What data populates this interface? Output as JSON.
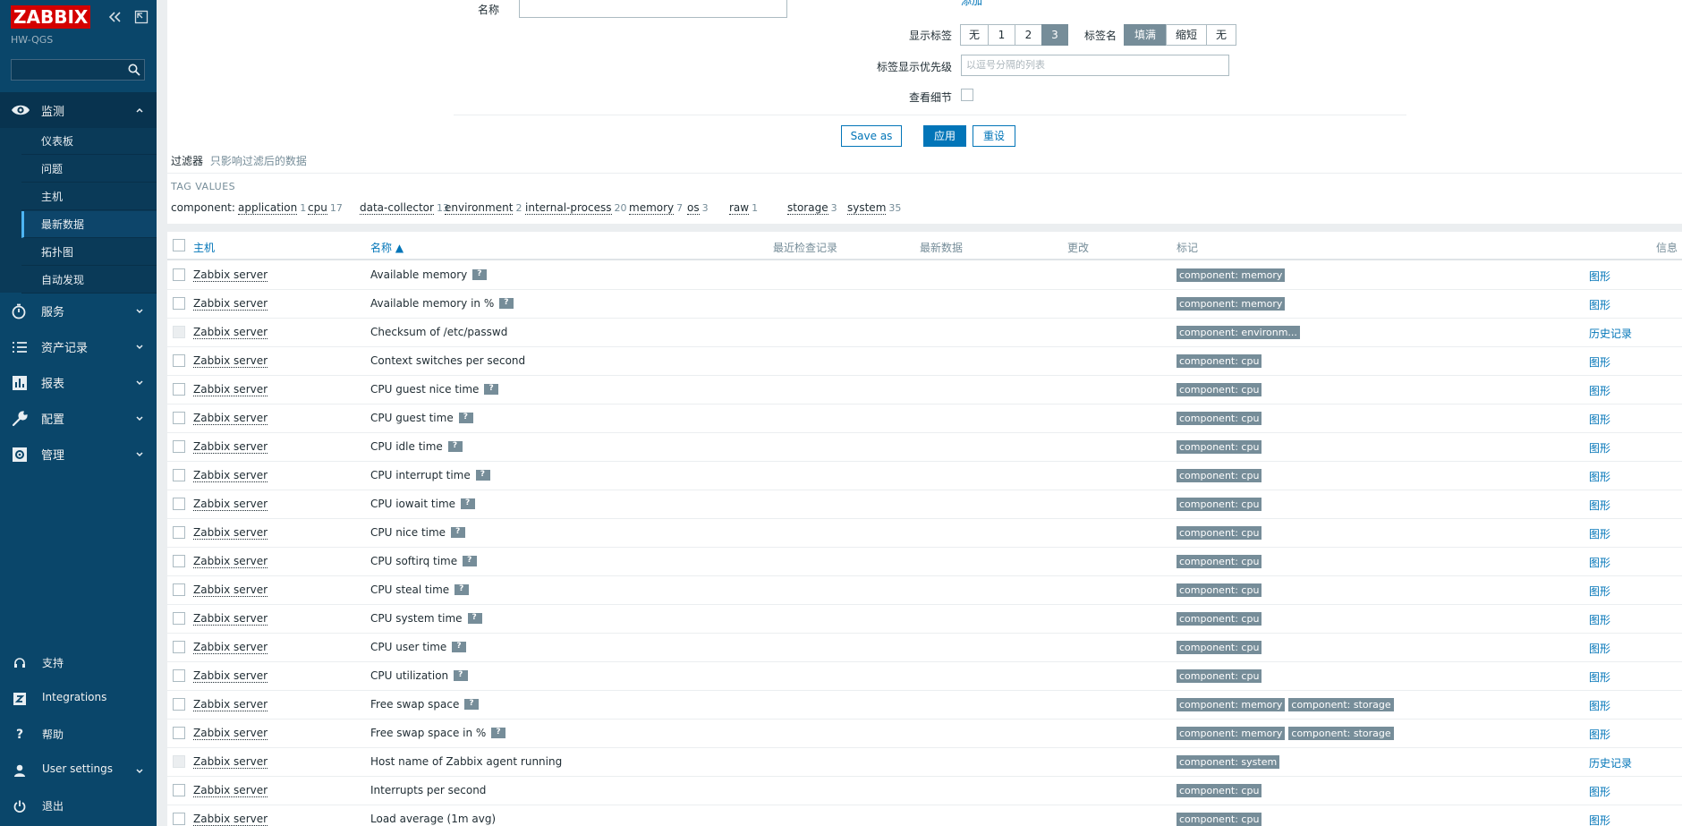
{
  "app": {
    "logo": "ZABBIX",
    "server_name": "HW-QGS",
    "search_placeholder": ""
  },
  "nav": {
    "monitoring": {
      "label": "监测",
      "items": [
        "仪表板",
        "问题",
        "主机",
        "最新数据",
        "拓扑图",
        "自动发现"
      ],
      "active": "最新数据"
    },
    "services": "服务",
    "inventory": "资产记录",
    "reports": "报表",
    "config": "配置",
    "admin": "管理",
    "support": "支持",
    "integrations": "Integrations",
    "help": "帮助",
    "user_settings": "User settings",
    "logout": "退出"
  },
  "filter": {
    "name_label": "名称",
    "name_value": "",
    "add_link": "添加",
    "show_tags_label": "显示标签",
    "show_tags_options": [
      "无",
      "1",
      "2",
      "3"
    ],
    "show_tags_selected": "3",
    "tag_name_label": "标签名",
    "tag_name_options": [
      "填满",
      "缩短",
      "无"
    ],
    "tag_name_selected": "填满",
    "tag_priority_label": "标签显示优先级",
    "tag_priority_placeholder": "以逗号分隔的列表",
    "show_details_label": "查看细节",
    "save_as": "Save as",
    "apply": "应用",
    "reset": "重设"
  },
  "filter_note": {
    "title": "过滤器",
    "subtitle": "只影响过滤后的数据"
  },
  "tag_values": {
    "heading": "TAG VALUES",
    "key": "component:",
    "items": [
      {
        "name": "application",
        "count": "1"
      },
      {
        "name": "cpu",
        "count": "17"
      },
      {
        "name": "data-collector",
        "count": "13"
      },
      {
        "name": "environment",
        "count": "2"
      },
      {
        "name": "internal-process",
        "count": "20"
      },
      {
        "name": "memory",
        "count": "7"
      },
      {
        "name": "os",
        "count": "3"
      },
      {
        "name": "raw",
        "count": "1"
      },
      {
        "name": "storage",
        "count": "3"
      },
      {
        "name": "system",
        "count": "35"
      }
    ]
  },
  "table": {
    "headers": {
      "host": "主机",
      "name": "名称 ▲",
      "last_check": "最近检查记录",
      "last_value": "最新数据",
      "change": "更改",
      "tags": "标记",
      "info": "信息"
    },
    "rows": [
      {
        "host": "Zabbix server",
        "name": "Available memory",
        "help": true,
        "tags": [
          "component: memory"
        ],
        "info": "图形",
        "disabled": false
      },
      {
        "host": "Zabbix server",
        "name": "Available memory in %",
        "help": true,
        "tags": [
          "component: memory"
        ],
        "info": "图形",
        "disabled": false
      },
      {
        "host": "Zabbix server",
        "name": "Checksum of /etc/passwd",
        "help": false,
        "tags": [
          "component: environm..."
        ],
        "info": "历史记录",
        "disabled": true
      },
      {
        "host": "Zabbix server",
        "name": "Context switches per second",
        "help": false,
        "tags": [
          "component: cpu"
        ],
        "info": "图形",
        "disabled": false
      },
      {
        "host": "Zabbix server",
        "name": "CPU guest nice time",
        "help": true,
        "tags": [
          "component: cpu"
        ],
        "info": "图形",
        "disabled": false
      },
      {
        "host": "Zabbix server",
        "name": "CPU guest time",
        "help": true,
        "tags": [
          "component: cpu"
        ],
        "info": "图形",
        "disabled": false
      },
      {
        "host": "Zabbix server",
        "name": "CPU idle time",
        "help": true,
        "tags": [
          "component: cpu"
        ],
        "info": "图形",
        "disabled": false
      },
      {
        "host": "Zabbix server",
        "name": "CPU interrupt time",
        "help": true,
        "tags": [
          "component: cpu"
        ],
        "info": "图形",
        "disabled": false
      },
      {
        "host": "Zabbix server",
        "name": "CPU iowait time",
        "help": true,
        "tags": [
          "component: cpu"
        ],
        "info": "图形",
        "disabled": false
      },
      {
        "host": "Zabbix server",
        "name": "CPU nice time",
        "help": true,
        "tags": [
          "component: cpu"
        ],
        "info": "图形",
        "disabled": false
      },
      {
        "host": "Zabbix server",
        "name": "CPU softirq time",
        "help": true,
        "tags": [
          "component: cpu"
        ],
        "info": "图形",
        "disabled": false
      },
      {
        "host": "Zabbix server",
        "name": "CPU steal time",
        "help": true,
        "tags": [
          "component: cpu"
        ],
        "info": "图形",
        "disabled": false
      },
      {
        "host": "Zabbix server",
        "name": "CPU system time",
        "help": true,
        "tags": [
          "component: cpu"
        ],
        "info": "图形",
        "disabled": false
      },
      {
        "host": "Zabbix server",
        "name": "CPU user time",
        "help": true,
        "tags": [
          "component: cpu"
        ],
        "info": "图形",
        "disabled": false
      },
      {
        "host": "Zabbix server",
        "name": "CPU utilization",
        "help": true,
        "tags": [
          "component: cpu"
        ],
        "info": "图形",
        "disabled": false
      },
      {
        "host": "Zabbix server",
        "name": "Free swap space",
        "help": true,
        "tags": [
          "component: memory",
          "component: storage"
        ],
        "info": "图形",
        "disabled": false
      },
      {
        "host": "Zabbix server",
        "name": "Free swap space in %",
        "help": true,
        "tags": [
          "component: memory",
          "component: storage"
        ],
        "info": "图形",
        "disabled": false
      },
      {
        "host": "Zabbix server",
        "name": "Host name of Zabbix agent running",
        "help": false,
        "tags": [
          "component: system"
        ],
        "info": "历史记录",
        "disabled": true
      },
      {
        "host": "Zabbix server",
        "name": "Interrupts per second",
        "help": false,
        "tags": [
          "component: cpu"
        ],
        "info": "图形",
        "disabled": false
      },
      {
        "host": "Zabbix server",
        "name": "Load average (1m avg)",
        "help": false,
        "tags": [
          "component: cpu"
        ],
        "info": "图形",
        "disabled": false
      }
    ]
  },
  "colors": {
    "sidebar_bg": "#0a466a",
    "accent": "#0275b8",
    "tag_bg": "#768d99",
    "logo_red": "#d40000"
  }
}
